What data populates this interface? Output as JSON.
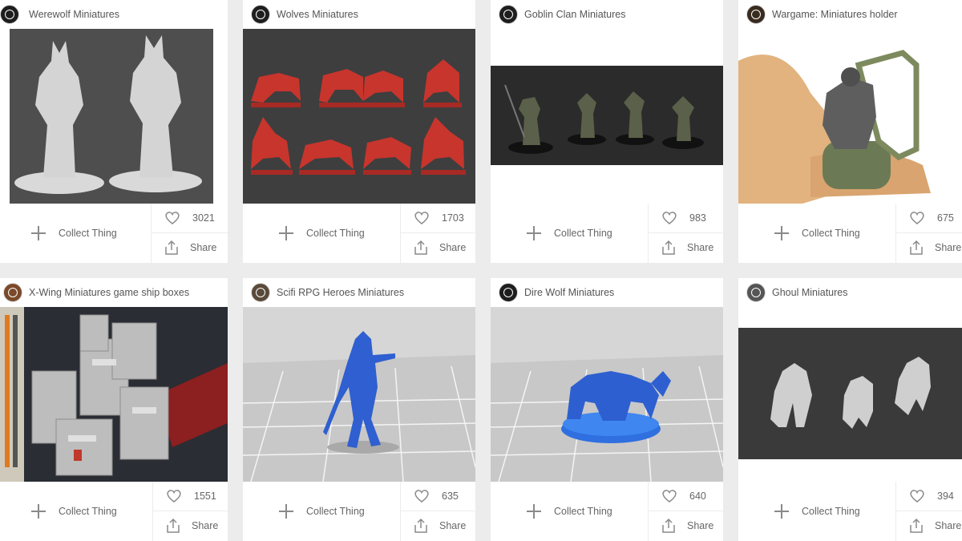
{
  "cards": [
    {
      "title": "Werewolf Miniatures",
      "likes": "3021",
      "collect_label": "Collect Thing",
      "share_label": "Share",
      "image": "werewolf-render"
    },
    {
      "title": "Wolves Miniatures",
      "likes": "1703",
      "collect_label": "Collect Thing",
      "share_label": "Share",
      "image": "red-wolves-render"
    },
    {
      "title": "Goblin Clan Miniatures",
      "likes": "983",
      "collect_label": "Collect Thing",
      "share_label": "Share",
      "image": "goblins-render"
    },
    {
      "title": "Wargame: Miniatures holder",
      "likes": "675",
      "collect_label": "Collect Thing",
      "share_label": "Share",
      "image": "holder-photo"
    },
    {
      "title": "X-Wing Miniatures game ship boxes",
      "likes": "1551",
      "collect_label": "Collect Thing",
      "share_label": "Share",
      "image": "xwing-boxes-photo"
    },
    {
      "title": "Scifi RPG Heroes Miniatures",
      "likes": "635",
      "collect_label": "Collect Thing",
      "share_label": "Share",
      "image": "blue-hero-render"
    },
    {
      "title": "Dire Wolf Miniatures",
      "likes": "640",
      "collect_label": "Collect Thing",
      "share_label": "Share",
      "image": "blue-direwolf-render"
    },
    {
      "title": "Ghoul Miniatures",
      "likes": "394",
      "collect_label": "Collect Thing",
      "share_label": "Share",
      "image": "ghouls-render"
    }
  ],
  "colors": {
    "page_bg": "#ececec",
    "card_bg": "#ffffff",
    "text": "#555555",
    "icon": "#8a8a8a"
  },
  "icons": {
    "collect": "plus-icon",
    "like": "heart-icon",
    "share": "share-icon"
  }
}
